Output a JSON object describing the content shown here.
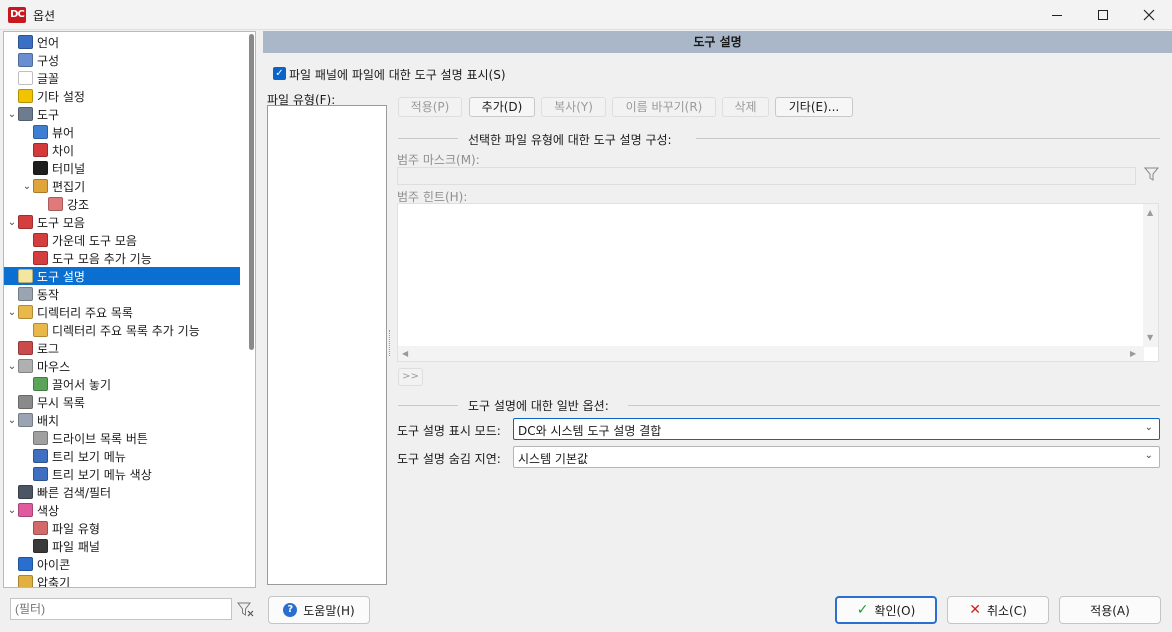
{
  "window": {
    "app_logo_text": "DC",
    "title": "옵션"
  },
  "tree": {
    "items": [
      {
        "label": "언어",
        "icon": "language-flag-icon",
        "color": "#3a6fc4",
        "level": 0,
        "chev": ""
      },
      {
        "label": "구성",
        "icon": "config-doc-icon",
        "color": "#6a8fd0",
        "level": 0,
        "chev": ""
      },
      {
        "label": "글꼴",
        "icon": "font-icon",
        "color": "#ffffff",
        "level": 0,
        "chev": ""
      },
      {
        "label": "기타 설정",
        "icon": "smiley-icon",
        "color": "#f2c300",
        "level": 0,
        "chev": ""
      },
      {
        "label": "도구",
        "icon": "tools-icon",
        "color": "#6e7c90",
        "level": 0,
        "chev": "v"
      },
      {
        "label": "뷰어",
        "icon": "viewer-book-icon",
        "color": "#3f7fd1",
        "level": 1,
        "chev": ""
      },
      {
        "label": "차이",
        "icon": "diff-icon",
        "color": "#d33a3a",
        "level": 1,
        "chev": ""
      },
      {
        "label": "터미널",
        "icon": "terminal-icon",
        "color": "#1e1e1e",
        "level": 1,
        "chev": ""
      },
      {
        "label": "편집기",
        "icon": "editor-icon",
        "color": "#e0a53a",
        "level": 1,
        "chev": "v"
      },
      {
        "label": "강조",
        "icon": "highlight-doc-icon",
        "color": "#e07a7a",
        "level": 2,
        "chev": ""
      },
      {
        "label": "도구 모음",
        "icon": "toolbar-scissors-icon",
        "color": "#d43e3e",
        "level": 0,
        "chev": "v"
      },
      {
        "label": "가운데 도구 모음",
        "icon": "middle-toolbar-icon",
        "color": "#d43e3e",
        "level": 1,
        "chev": ""
      },
      {
        "label": "도구 모음 추가 기능",
        "icon": "toolbar-extra-icon",
        "color": "#d43e3e",
        "level": 1,
        "chev": ""
      },
      {
        "label": "도구 설명",
        "icon": "tooltip-bulb-icon",
        "color": "#f2e6a0",
        "level": 0,
        "chev": "",
        "selected": true
      },
      {
        "label": "동작",
        "icon": "behavior-icon",
        "color": "#9aa4b2",
        "level": 0,
        "chev": ""
      },
      {
        "label": "디렉터리 주요 목록",
        "icon": "folder-hotlist-icon",
        "color": "#e8b84a",
        "level": 0,
        "chev": "v"
      },
      {
        "label": "디렉터리 주요 목록 추가 기능",
        "icon": "folder-extra-icon",
        "color": "#e8b84a",
        "level": 1,
        "chev": ""
      },
      {
        "label": "로그",
        "icon": "log-icon",
        "color": "#c94b4b",
        "level": 0,
        "chev": ""
      },
      {
        "label": "마우스",
        "icon": "mouse-icon",
        "color": "#b0b0b0",
        "level": 0,
        "chev": "v"
      },
      {
        "label": "끌어서 놓기",
        "icon": "drag-drop-icon",
        "color": "#5aa55a",
        "level": 1,
        "chev": ""
      },
      {
        "label": "무시 목록",
        "icon": "ignore-list-icon",
        "color": "#8a8a8a",
        "level": 0,
        "chev": ""
      },
      {
        "label": "배치",
        "icon": "layout-icon",
        "color": "#9aa4b2",
        "level": 0,
        "chev": "v"
      },
      {
        "label": "드라이브 목록 버튼",
        "icon": "drive-button-icon",
        "color": "#a0a0a0",
        "level": 1,
        "chev": ""
      },
      {
        "label": "트리 보기 메뉴",
        "icon": "tree-menu-icon",
        "color": "#3f6fc0",
        "level": 1,
        "chev": ""
      },
      {
        "label": "트리 보기 메뉴 색상",
        "icon": "tree-menu-color-icon",
        "color": "#3f6fc0",
        "level": 1,
        "chev": ""
      },
      {
        "label": "빠른 검색/필터",
        "icon": "quick-search-icon",
        "color": "#4b5563",
        "level": 0,
        "chev": ""
      },
      {
        "label": "색상",
        "icon": "color-wheel-icon",
        "color": "#e05aa0",
        "level": 0,
        "chev": "v"
      },
      {
        "label": "파일 유형",
        "icon": "file-types-icon",
        "color": "#d36a6a",
        "level": 1,
        "chev": ""
      },
      {
        "label": "파일 패널",
        "icon": "file-panel-icon",
        "color": "#3a3a3a",
        "level": 1,
        "chev": ""
      },
      {
        "label": "아이콘",
        "icon": "icons-footprint-icon",
        "color": "#2a6fd0",
        "level": 0,
        "chev": ""
      },
      {
        "label": "압축기",
        "icon": "archiver-icon",
        "color": "#e0b040",
        "level": 0,
        "chev": ""
      }
    ]
  },
  "filter": {
    "placeholder": "(필터)",
    "clear_icon": "filter-clear-icon"
  },
  "section": {
    "title": "도구 설명"
  },
  "show_tooltip_checkbox": {
    "label": "파일 패널에 파일에 대한 도구 설명 표시(S)",
    "checked": true
  },
  "file_types": {
    "label": "파일 유형(F):"
  },
  "toolbar": {
    "apply": "적용(P)",
    "add": "추가(D)",
    "copy": "복사(Y)",
    "rename": "이름 바꾸기(R)",
    "delete": "삭제",
    "other": "기타(E)..."
  },
  "config_group": {
    "title": "선택한 파일 유형에 대한 도구 설명 구성:",
    "mask_label": "범주 마스크(M):",
    "hint_label": "범주 힌트(H):",
    "expand_button": ">>"
  },
  "general_group": {
    "title": "도구 설명에 대한 일반 옵션:",
    "mode_label": "도구 설명 표시 모드:",
    "mode_value": "DC와 시스템 도구 설명 결합",
    "delay_label": "도구 설명 숨김 지연:",
    "delay_value": "시스템 기본값"
  },
  "bottom": {
    "help": "도움말(H)",
    "ok": "확인(O)",
    "cancel": "취소(C)",
    "apply": "적용(A)"
  },
  "colors": {
    "header_bg": "#a9b7c8",
    "selection": "#0a6fd0",
    "checkbox": "#0a63c9"
  }
}
